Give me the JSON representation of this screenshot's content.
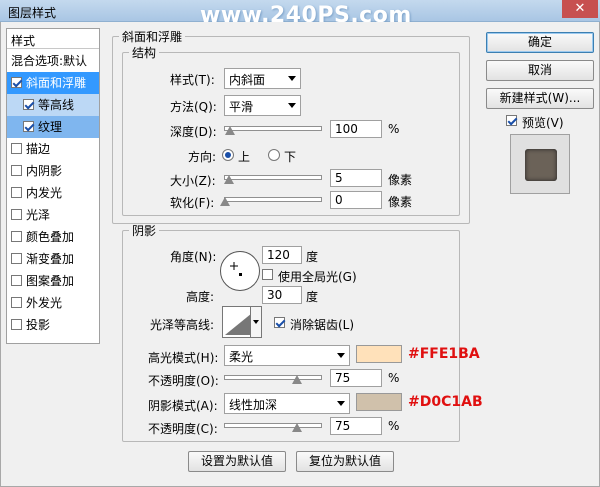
{
  "window": {
    "title": "图层样式",
    "watermark": "www.240PS.com",
    "close": "✕"
  },
  "left_panel": {
    "header": "样式",
    "items": [
      {
        "label": "混合选项:默认",
        "checkbox": false,
        "state": "plain"
      },
      {
        "label": "斜面和浮雕",
        "checkbox": true,
        "checked": true,
        "state": "selected"
      },
      {
        "label": "等高线",
        "checkbox": true,
        "checked": true,
        "state": "sub"
      },
      {
        "label": "纹理",
        "checkbox": true,
        "checked": true,
        "state": "sub-on"
      },
      {
        "label": "描边",
        "checkbox": true,
        "checked": false
      },
      {
        "label": "内阴影",
        "checkbox": true,
        "checked": false
      },
      {
        "label": "内发光",
        "checkbox": true,
        "checked": false
      },
      {
        "label": "光泽",
        "checkbox": true,
        "checked": false
      },
      {
        "label": "颜色叠加",
        "checkbox": true,
        "checked": false
      },
      {
        "label": "渐变叠加",
        "checkbox": true,
        "checked": false
      },
      {
        "label": "图案叠加",
        "checkbox": true,
        "checked": false
      },
      {
        "label": "外发光",
        "checkbox": true,
        "checked": false
      },
      {
        "label": "投影",
        "checkbox": true,
        "checked": false
      }
    ]
  },
  "bevel": {
    "group_title": "斜面和浮雕",
    "structure_title": "结构",
    "style_label": "样式(T):",
    "style_value": "内斜面",
    "technique_label": "方法(Q):",
    "technique_value": "平滑",
    "depth_label": "深度(D):",
    "depth_value": "100",
    "depth_unit": "%",
    "depth_slider": 0.05,
    "direction_label": "方向:",
    "dir_up": "上",
    "dir_down": "下",
    "size_label": "大小(Z):",
    "size_value": "5",
    "size_unit": "像素",
    "size_slider": 0.04,
    "soften_label": "软化(F):",
    "soften_value": "0",
    "soften_unit": "像素",
    "soften_slider": 0.0
  },
  "shading": {
    "title": "阴影",
    "angle_label": "角度(N):",
    "angle_value": "120",
    "angle_unit": "度",
    "global_light_label": "使用全局光(G)",
    "global_light_checked": false,
    "altitude_label": "高度:",
    "altitude_value": "30",
    "altitude_unit": "度",
    "gloss_label": "光泽等高线:",
    "antialias_label": "消除锯齿(L)",
    "antialias_checked": true,
    "highlight_label": "高光模式(H):",
    "highlight_mode": "柔光",
    "highlight_color": "#FFE1BA",
    "highlight_hex": "#FFE1BA",
    "opacity1_label": "不透明度(O):",
    "opacity1_value": "75",
    "opacity1_unit": "%",
    "opacity1_slider": 0.75,
    "shadow_label": "阴影模式(A):",
    "shadow_mode": "线性加深",
    "shadow_color": "#D0C1AB",
    "shadow_hex": "#D0C1AB",
    "opacity2_label": "不透明度(C):",
    "opacity2_value": "75",
    "opacity2_unit": "%",
    "opacity2_slider": 0.75
  },
  "footer": {
    "make_default": "设置为默认值",
    "reset_default": "复位为默认值"
  },
  "right": {
    "ok": "确定",
    "cancel": "取消",
    "new_style": "新建样式(W)...",
    "preview_label": "预览(V)",
    "preview_checked": true
  }
}
